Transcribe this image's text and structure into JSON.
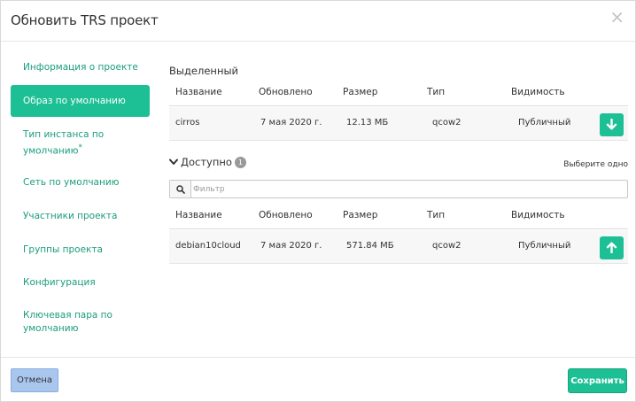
{
  "dialog": {
    "title": "Обновить TRS проект",
    "close_glyph": "×"
  },
  "nav": {
    "items": [
      {
        "label": "Информация о проекте"
      },
      {
        "label": "Образ по умолчанию",
        "active": true
      },
      {
        "label_line1": "Тип инстанса по",
        "label_line2": "умолчанию",
        "required_mark": "*"
      },
      {
        "label": "Сеть по умолчанию"
      },
      {
        "label": "Участники проекта"
      },
      {
        "label": "Группы проекта"
      },
      {
        "label": "Конфигурация"
      },
      {
        "label_line1": "Ключевая пара по",
        "label_line2": "умолчанию"
      }
    ]
  },
  "selected": {
    "label": "Выделенный",
    "columns": [
      "Название",
      "Обновлено",
      "Размер",
      "Тип",
      "Видимость"
    ],
    "rows": [
      {
        "name": "cirros",
        "updated": "7 мая 2020 г.",
        "size": "12.13 МБ",
        "type": "qcow2",
        "visibility": "Публичный",
        "action_icon": "arrow-down-icon"
      }
    ]
  },
  "available": {
    "label": "Доступно",
    "count": "1",
    "hint": "Выберите одно",
    "filter_placeholder": "Фильтр",
    "filter_value": "",
    "columns": [
      "Название",
      "Обновлено",
      "Размер",
      "Тип",
      "Видимость"
    ],
    "rows": [
      {
        "name": "debian10cloud",
        "updated": "7 мая 2020 г.",
        "size": "571.84 МБ",
        "type": "qcow2",
        "visibility": "Публичный",
        "action_icon": "arrow-up-icon"
      }
    ]
  },
  "footer": {
    "cancel_label": "Отмена",
    "save_label": "Сохранить"
  },
  "colors": {
    "accent": "#1dbf94",
    "link": "#1a9c7e",
    "cancel_bg": "#a9c7ee"
  }
}
